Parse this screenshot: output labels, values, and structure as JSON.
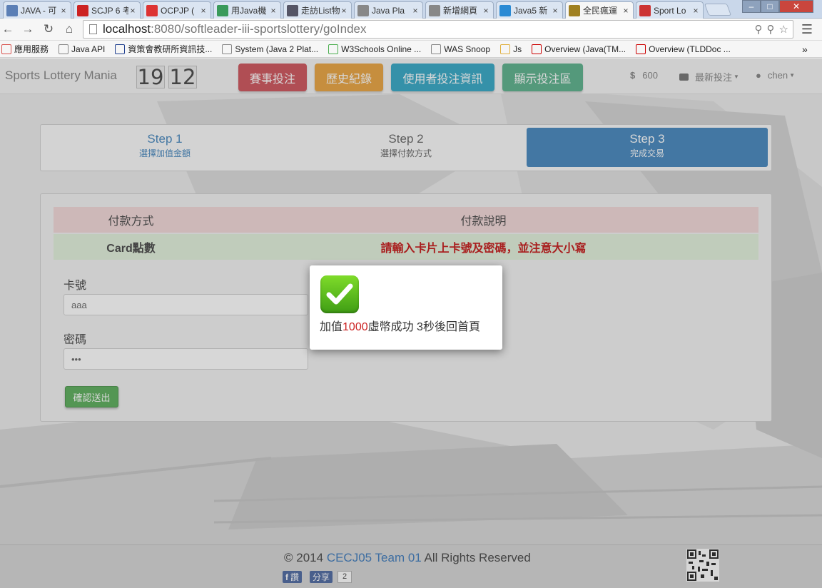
{
  "browser": {
    "tabs": [
      {
        "title": "JAVA - 可",
        "icon": "generic-page-icon",
        "color": "#5b7fb6"
      },
      {
        "title": "SCJP 6 考",
        "icon": "youtube-icon",
        "color": "#cc2222"
      },
      {
        "title": "OCPJP (",
        "icon": "pdf-icon",
        "color": "#d33"
      },
      {
        "title": "用Java機",
        "icon": "chrome-c-icon",
        "color": "#3a9a5a"
      },
      {
        "title": "走訪List物",
        "icon": "image-icon",
        "color": "#556"
      },
      {
        "title": "Java Pla",
        "icon": "document-icon",
        "color": "#888"
      },
      {
        "title": "新增網頁",
        "icon": "document-icon",
        "color": "#888"
      },
      {
        "title": "Java5 新",
        "icon": "cube-icon",
        "color": "#2a8ad4"
      },
      {
        "title": "全民瘋運",
        "icon": "lottery-site-icon",
        "color": "#a08020",
        "active": true
      },
      {
        "title": "Sport Lo",
        "icon": "gmail-icon",
        "color": "#c33"
      }
    ],
    "close_glyph": "×",
    "url_host": "localhost",
    "url_path": ":8080/softleader-iii-sportslottery/goIndex",
    "bookmarks": [
      {
        "label": "應用服務",
        "icon": "apps-grid-icon"
      },
      {
        "label": "Java API",
        "icon": "document-icon"
      },
      {
        "label": "資策會教研所資訊技...",
        "icon": "institute-icon"
      },
      {
        "label": "System (Java 2 Plat...",
        "icon": "document-icon"
      },
      {
        "label": "W3Schools Online ...",
        "icon": "w3schools-icon"
      },
      {
        "label": "WAS Snoop",
        "icon": "document-icon"
      },
      {
        "label": "Js",
        "icon": "folder-icon"
      },
      {
        "label": "Overview (Java(TM...",
        "icon": "oracle-icon"
      },
      {
        "label": "Overview (TLDDoc ...",
        "icon": "oracle-icon"
      }
    ],
    "bookmarks_overflow": "»"
  },
  "navbar": {
    "brand": "Sports Lottery Mania",
    "clock_hours": "19",
    "clock_minutes": "12",
    "buttons": [
      {
        "label": "賽事投注",
        "color": "#c9424a"
      },
      {
        "label": "歷史紀錄",
        "color": "#e89a2c"
      },
      {
        "label": "使用者投注資訊",
        "color": "#1f9fc0"
      },
      {
        "label": "顯示投注區",
        "color": "#4aaa80"
      }
    ],
    "balance_symbol": "$",
    "balance": "600",
    "latest_bets": "最新投注",
    "user": "chen"
  },
  "steps": [
    {
      "title": "Step 1",
      "desc": "選擇加值金額",
      "state": "link"
    },
    {
      "title": "Step 2",
      "desc": "選擇付款方式",
      "state": "normal"
    },
    {
      "title": "Step 3",
      "desc": "完成交易",
      "state": "active"
    }
  ],
  "payment_table": {
    "headers": [
      "付款方式",
      "付款說明"
    ],
    "row": [
      "Card點數",
      "請輸入卡片上卡號及密碼，並注意大小寫"
    ],
    "header_bg": "#f2d5d5",
    "row_bg": "#dff0d8",
    "instruction_color": "#c00000"
  },
  "form": {
    "card_label": "卡號",
    "card_value": "aaa",
    "password_label": "密碼",
    "password_value": "•••",
    "submit_label": "確認送出"
  },
  "modal": {
    "prefix": "加值",
    "amount": "1000",
    "suffix": "虛幣成功 3秒後回首頁"
  },
  "footer": {
    "copyright": "© 2014",
    "team": "CECJ05 Team 01",
    "rights": "All Rights Reserved",
    "fb_like": "讚",
    "fb_share": "分享",
    "fb_count": "2"
  }
}
